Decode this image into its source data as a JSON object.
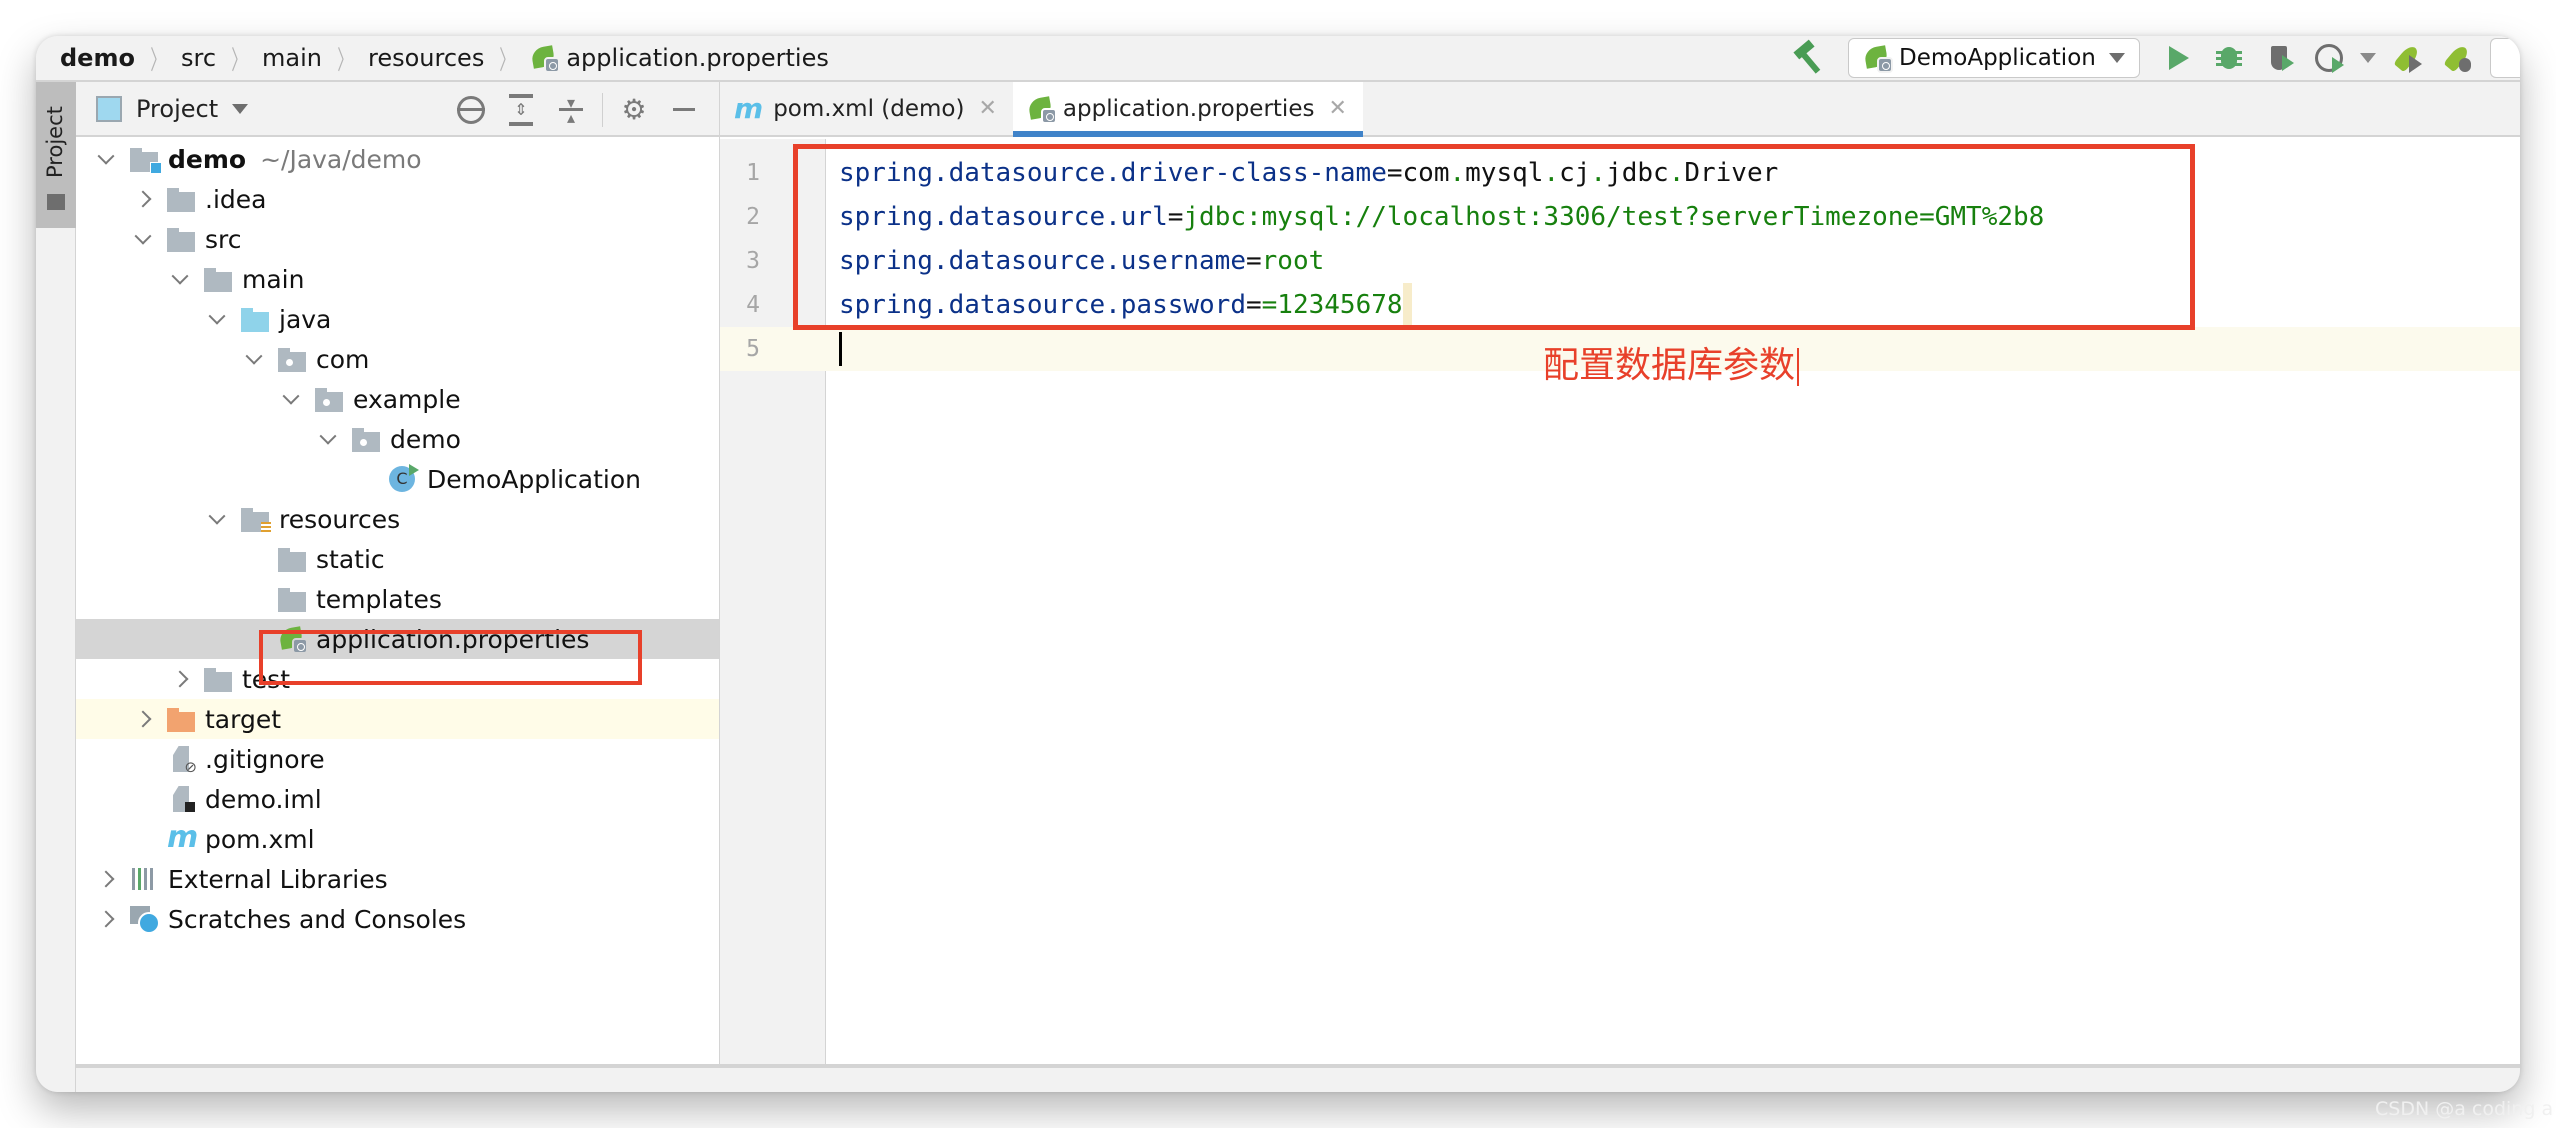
{
  "breadcrumb": {
    "items": [
      "demo",
      "src",
      "main",
      "resources",
      "application.properties"
    ]
  },
  "run_toolbar": {
    "run_config": "DemoApplication",
    "icons": [
      "build-hammer-icon",
      "run-icon",
      "debug-icon",
      "coverage-icon",
      "profile-icon",
      "run-spring-icon",
      "debug-spring-icon"
    ]
  },
  "tool_stripe": {
    "project_tab": "Project"
  },
  "project_panel": {
    "title": "Project",
    "actions": [
      "locate-icon",
      "expand-all-icon",
      "collapse-all-icon",
      "gear-icon",
      "minimize-icon"
    ],
    "tree": [
      {
        "label": "demo",
        "path": "~/Java/demo",
        "level": 0,
        "chevron": "down",
        "icon": "module",
        "bold": true
      },
      {
        "label": ".idea",
        "level": 1,
        "chevron": "right",
        "icon": "folder"
      },
      {
        "label": "src",
        "level": 1,
        "chevron": "down",
        "icon": "folder"
      },
      {
        "label": "main",
        "level": 2,
        "chevron": "down",
        "icon": "folder"
      },
      {
        "label": "java",
        "level": 3,
        "chevron": "down",
        "icon": "source-folder"
      },
      {
        "label": "com",
        "level": 4,
        "chevron": "down",
        "icon": "package"
      },
      {
        "label": "example",
        "level": 5,
        "chevron": "down",
        "icon": "package"
      },
      {
        "label": "demo",
        "level": 6,
        "chevron": "down",
        "icon": "package"
      },
      {
        "label": "DemoApplication",
        "level": 7,
        "chevron": "none",
        "icon": "spring-class"
      },
      {
        "label": "resources",
        "level": 3,
        "chevron": "down",
        "icon": "resources-folder"
      },
      {
        "label": "static",
        "level": 4,
        "chevron": "none",
        "icon": "folder"
      },
      {
        "label": "templates",
        "level": 4,
        "chevron": "none",
        "icon": "folder"
      },
      {
        "label": "application.properties",
        "level": 4,
        "chevron": "none",
        "icon": "spring-properties",
        "selected": true
      },
      {
        "label": "test",
        "level": 2,
        "chevron": "right",
        "icon": "folder"
      },
      {
        "label": "target",
        "level": 1,
        "chevron": "right",
        "icon": "excluded-folder",
        "excluded": true
      },
      {
        "label": ".gitignore",
        "level": 1,
        "chevron": "none",
        "icon": "gitignore-file"
      },
      {
        "label": "demo.iml",
        "level": 1,
        "chevron": "none",
        "icon": "iml-file"
      },
      {
        "label": "pom.xml",
        "level": 1,
        "chevron": "none",
        "icon": "maven-file"
      },
      {
        "label": "External Libraries",
        "level": 0,
        "chevron": "right",
        "icon": "libraries"
      },
      {
        "label": "Scratches and Consoles",
        "level": 0,
        "chevron": "right",
        "icon": "scratches"
      }
    ]
  },
  "editor": {
    "tabs": [
      {
        "label": "pom.xml (demo)",
        "icon": "maven-icon",
        "active": false
      },
      {
        "label": "application.properties",
        "icon": "spring-icon",
        "active": true
      }
    ],
    "lines": [
      {
        "number": "1",
        "key": "spring.datasource.driver-class-name",
        "eq": "=",
        "value_parts": [
          {
            "t": "com",
            "c": "vb"
          },
          {
            "t": ".",
            "c": "dot"
          },
          {
            "t": "mysql",
            "c": "vb"
          },
          {
            "t": ".",
            "c": "dot"
          },
          {
            "t": "cj",
            "c": "vb"
          },
          {
            "t": ".",
            "c": "dot"
          },
          {
            "t": "jdbc",
            "c": "vb"
          },
          {
            "t": ".",
            "c": "dot"
          },
          {
            "t": "Driver",
            "c": "vb"
          }
        ]
      },
      {
        "number": "2",
        "key": "spring.datasource.url",
        "eq": "=",
        "value_parts": [
          {
            "t": "jdbc:mysql://localhost:3306/test?serverTimezone=GMT%2b8",
            "c": "v"
          }
        ]
      },
      {
        "number": "3",
        "key": "spring.datasource.username",
        "eq": "=",
        "value_parts": [
          {
            "t": "root",
            "c": "v"
          }
        ]
      },
      {
        "number": "4",
        "key": "spring.datasource.password",
        "eq": "=",
        "value_parts": [
          {
            "t": "=12345678",
            "c": "v"
          }
        ]
      },
      {
        "number": "5",
        "key": "",
        "eq": "",
        "value_parts": [],
        "current": true
      }
    ]
  },
  "annotation": {
    "text": "配置数据库参数",
    "color": "#e8402a"
  },
  "colors": {
    "key": "#0b3188",
    "value": "#17800e",
    "accent_tab": "#4083c9",
    "selection": "#d5d5d5"
  },
  "watermark": "CSDN @a coding a"
}
